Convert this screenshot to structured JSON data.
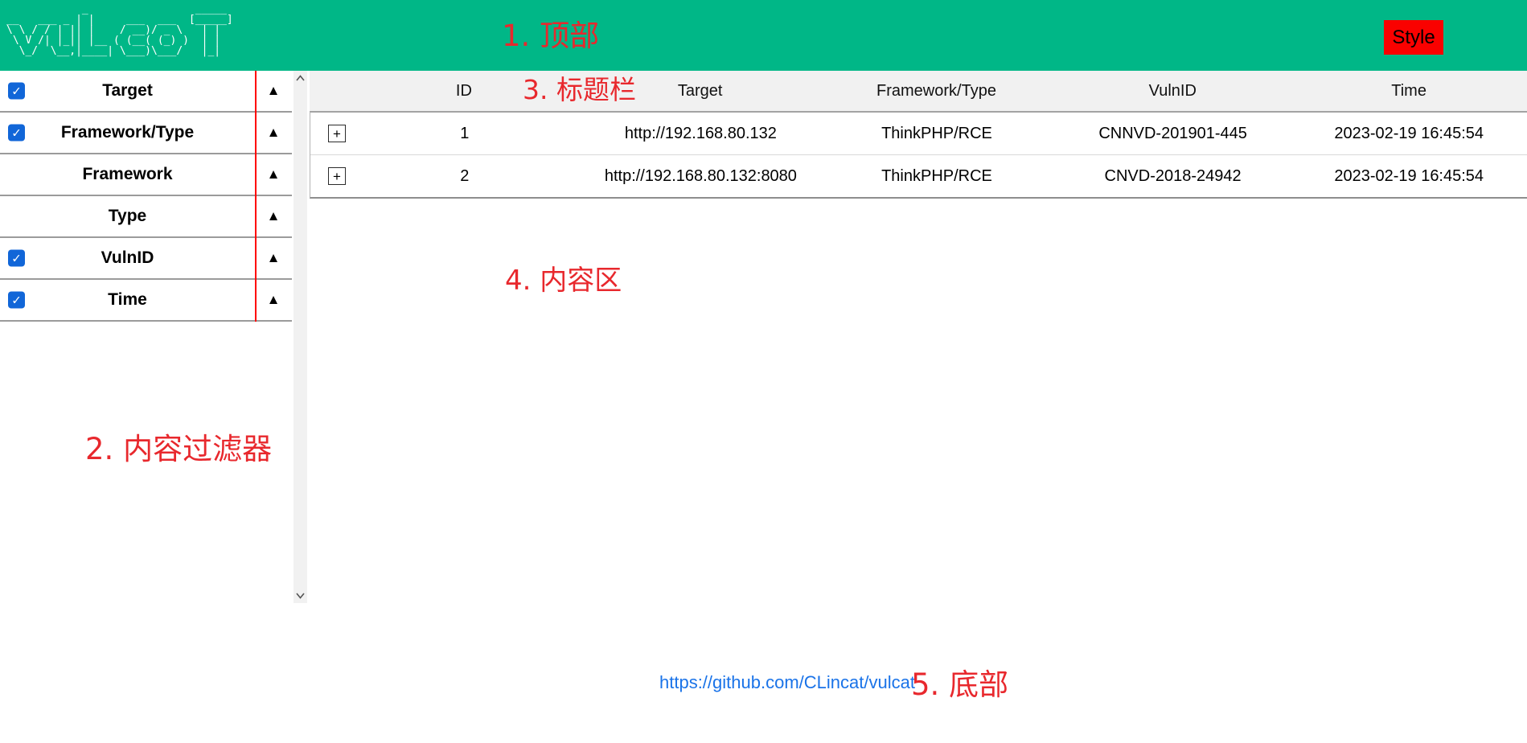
{
  "header": {
    "logo_ascii": "            _                 _____\n__   ___ _ | |     ___  ___  [_____]\n\\ \\ / / | || |    / __)/ _ \\   | |\n \\ V /| |_|| |__ ( (__( (_) )  | |\n  \\_/  \\__,|____| \\___)\\___/   |_|",
    "annotation": "1. 顶部",
    "style_button": "Style"
  },
  "filter_panel": {
    "annotation": "2. 内容过滤器",
    "items": [
      {
        "label": "Target",
        "checked": true
      },
      {
        "label": "Framework/Type",
        "checked": true
      },
      {
        "label": "Framework",
        "checked": false
      },
      {
        "label": "Type",
        "checked": false
      },
      {
        "label": "VulnID",
        "checked": true
      },
      {
        "label": "Time",
        "checked": true
      }
    ]
  },
  "table": {
    "annotation_header": "3. 标题栏",
    "annotation_content": "4. 内容区",
    "columns": [
      "ID",
      "Target",
      "Framework/Type",
      "VulnID",
      "Time"
    ],
    "rows": [
      {
        "id": "1",
        "target": "http://192.168.80.132",
        "framework_type": "ThinkPHP/RCE",
        "vuln_id": "CNNVD-201901-445",
        "time": "2023-02-19 16:45:54"
      },
      {
        "id": "2",
        "target": "http://192.168.80.132:8080",
        "framework_type": "ThinkPHP/RCE",
        "vuln_id": "CNVD-2018-24942",
        "time": "2023-02-19 16:45:54"
      }
    ]
  },
  "footer": {
    "link_text": "https://github.com/CLincat/vulcat",
    "annotation": "5. 底部"
  },
  "icons": {
    "check": "✓",
    "sort_up": "▲",
    "expand": "+"
  },
  "colors": {
    "header_green": "#00b787",
    "annotation_red": "#e8282d",
    "style_button_red": "#fa0100",
    "link_blue": "#1a73e8",
    "checkbox_blue": "#1166d8",
    "divider_red": "#ff0000"
  }
}
